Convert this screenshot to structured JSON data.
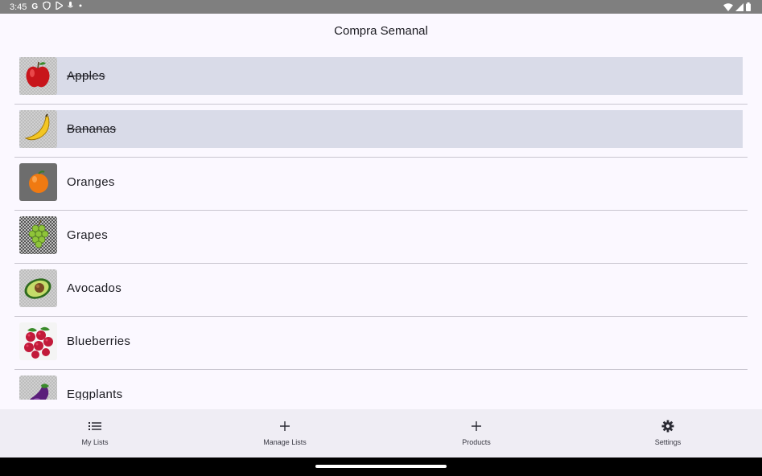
{
  "status_bar": {
    "time": "3:45",
    "icons_left": [
      "google-icon",
      "shield-icon",
      "play-icon",
      "mic-icon",
      "dot-icon"
    ],
    "icons_right": [
      "wifi-icon",
      "signal-icon",
      "battery-icon"
    ]
  },
  "header": {
    "title": "Compra Semanal"
  },
  "items": [
    {
      "label": "Apples",
      "checked": true,
      "icon": "apple-icon"
    },
    {
      "label": "Bananas",
      "checked": true,
      "icon": "banana-icon"
    },
    {
      "label": "Oranges",
      "checked": false,
      "icon": "orange-icon"
    },
    {
      "label": "Grapes",
      "checked": false,
      "icon": "grapes-icon"
    },
    {
      "label": "Avocados",
      "checked": false,
      "icon": "avocado-icon"
    },
    {
      "label": "Blueberries",
      "checked": false,
      "icon": "berries-icon"
    },
    {
      "label": "Eggplants",
      "checked": false,
      "icon": "eggplant-icon"
    }
  ],
  "nav": [
    {
      "label": "My Lists",
      "icon": "list-icon"
    },
    {
      "label": "Manage Lists",
      "icon": "plus-icon"
    },
    {
      "label": "Products",
      "icon": "plus-icon"
    },
    {
      "label": "Settings",
      "icon": "gear-icon"
    }
  ],
  "colors": {
    "background": "#fbf8ff",
    "checked_row": "#d9dbe8",
    "nav_bar": "#efedf4",
    "status_bar": "#7f7f7f"
  }
}
